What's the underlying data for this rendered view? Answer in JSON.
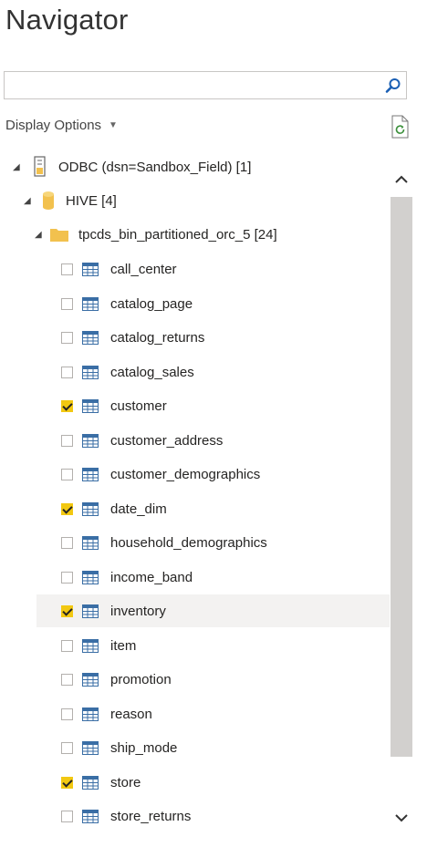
{
  "header": {
    "title": "Navigator"
  },
  "search": {
    "value": "",
    "placeholder": ""
  },
  "toolbar": {
    "display_options_label": "Display Options"
  },
  "tree": {
    "root": {
      "label": "ODBC (dsn=Sandbox_Field) [1]"
    },
    "database": {
      "label": "HIVE [4]"
    },
    "schema": {
      "label": "tpcds_bin_partitioned_orc_5 [24]"
    },
    "tables": [
      {
        "label": "call_center",
        "checked": false
      },
      {
        "label": "catalog_page",
        "checked": false
      },
      {
        "label": "catalog_returns",
        "checked": false
      },
      {
        "label": "catalog_sales",
        "checked": false
      },
      {
        "label": "customer",
        "checked": true
      },
      {
        "label": "customer_address",
        "checked": false
      },
      {
        "label": "customer_demographics",
        "checked": false
      },
      {
        "label": "date_dim",
        "checked": true
      },
      {
        "label": "household_demographics",
        "checked": false
      },
      {
        "label": "income_band",
        "checked": false
      },
      {
        "label": "inventory",
        "checked": true,
        "highlighted": true
      },
      {
        "label": "item",
        "checked": false
      },
      {
        "label": "promotion",
        "checked": false
      },
      {
        "label": "reason",
        "checked": false
      },
      {
        "label": "ship_mode",
        "checked": false
      },
      {
        "label": "store",
        "checked": true
      },
      {
        "label": "store_returns",
        "checked": false
      }
    ]
  },
  "colors": {
    "checked": "#f2c811",
    "folder": "#f2c14e",
    "table_icon": "#3a6ea5",
    "scroll_thumb": "#d2d0ce"
  },
  "icons": {
    "search": "magnifier-icon",
    "refresh": "document-refresh-icon",
    "odbc": "server-icon",
    "database": "cylinder-icon",
    "schema": "folder-icon",
    "table": "table-grid-icon"
  }
}
